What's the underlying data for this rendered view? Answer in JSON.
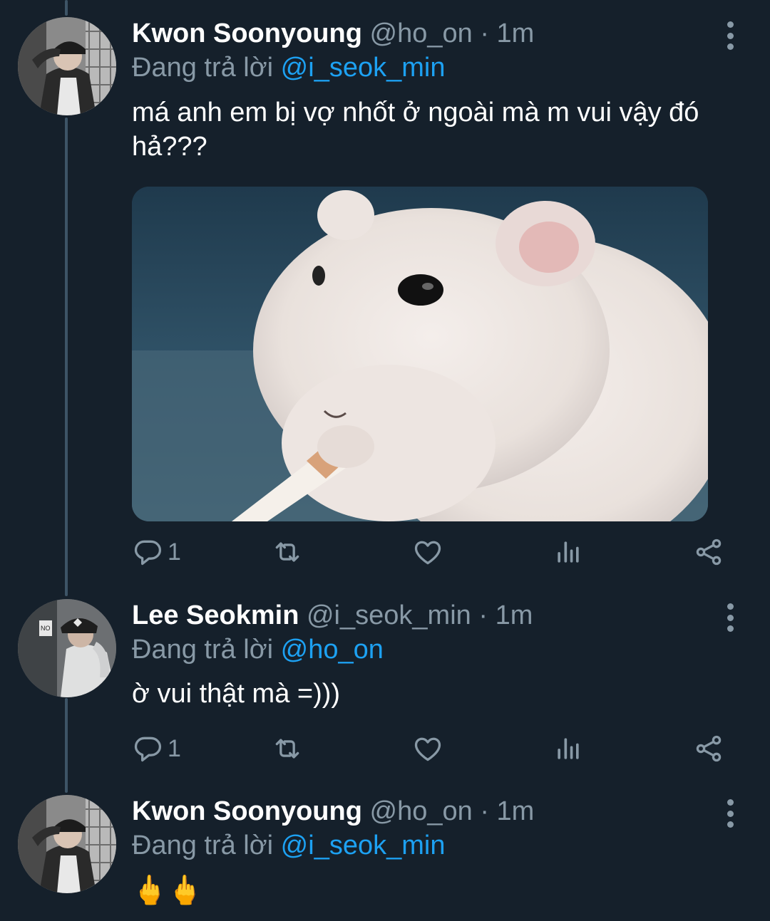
{
  "tweets": [
    {
      "name": "Kwon Soonyoung",
      "handle": "@ho_on",
      "separator": "·",
      "time": "1m",
      "reply_prefix": "Đang trả lời",
      "reply_to": "@i_seok_min",
      "text": "má anh em bị vợ nhốt ở ngoài mà m vui vậy đó hả???",
      "has_media": true,
      "media_icon": "hamster-gif-image",
      "reply_count": "1"
    },
    {
      "name": "Lee Seokmin",
      "handle": "@i_seok_min",
      "separator": "·",
      "time": "1m",
      "reply_prefix": "Đang trả lời",
      "reply_to": "@ho_on",
      "text": "ờ vui thật mà =)))",
      "has_media": false,
      "reply_count": "1"
    },
    {
      "name": "Kwon Soonyoung",
      "handle": "@ho_on",
      "separator": "·",
      "time": "1m",
      "reply_prefix": "Đang trả lời",
      "reply_to": "@i_seok_min",
      "text": "🖕🖕",
      "has_media": false
    }
  ],
  "icons": {
    "reply": "reply-icon",
    "retweet": "retweet-icon",
    "like": "like-icon",
    "analytics": "analytics-icon",
    "share": "share-icon",
    "more": "more-options-icon"
  },
  "colors": {
    "background": "#15202b",
    "text_secondary": "#8899a6",
    "mention": "#1da1f2",
    "thread_line": "#3d5466"
  }
}
